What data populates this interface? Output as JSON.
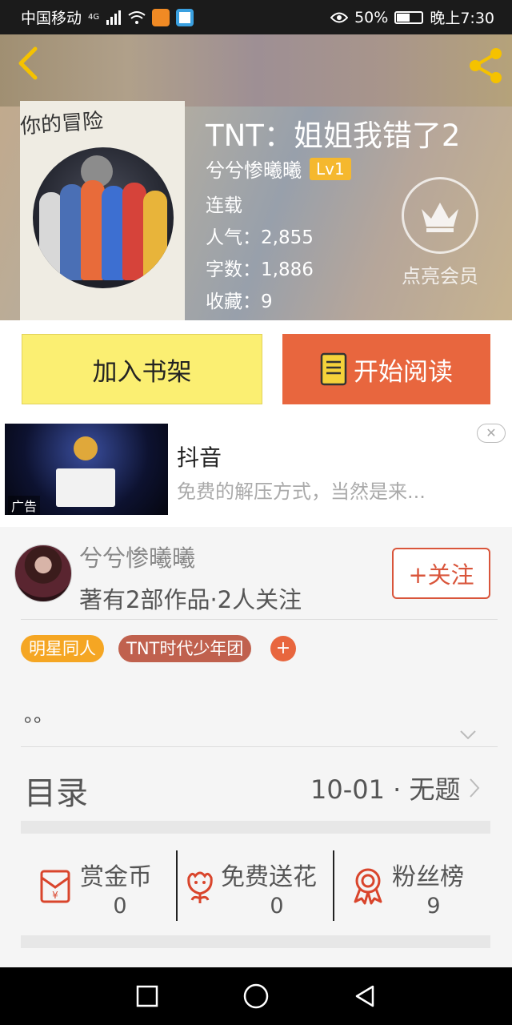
{
  "status_bar": {
    "carrier": "中国移动",
    "network": "4G",
    "battery": "50%",
    "time": "晚上7:30"
  },
  "book": {
    "title": "TNT：姐姐我错了2",
    "author": "兮兮惨曦曦",
    "author_level": "Lv1",
    "status": "连载",
    "popularity": "人气：2,855",
    "word_count": "字数：1,886",
    "favorites": "收藏：9",
    "cover_title": "你的冒险"
  },
  "vip": {
    "label": "点亮会员"
  },
  "actions": {
    "add_to_shelf": "加入书架",
    "start_reading": "开始阅读"
  },
  "ad": {
    "title": "抖音",
    "description": "免费的解压方式，当然是来...",
    "tag": "广告"
  },
  "author_section": {
    "name": "兮兮惨曦曦",
    "works": "著有2部作品·2人关注",
    "follow": "+关注"
  },
  "tags": [
    {
      "label": "明星同人",
      "color": "#f5a623"
    },
    {
      "label": "TNT时代少年团",
      "color": "#c0614e"
    }
  ],
  "tag_add": "+",
  "intro": "。。",
  "toc": {
    "label": "目录",
    "latest": "10-01 · 无题"
  },
  "stats": [
    {
      "label": "赏金币",
      "value": "0",
      "icon": "red-envelope-icon"
    },
    {
      "label": "免费送花",
      "value": "0",
      "icon": "flower-icon"
    },
    {
      "label": "粉丝榜",
      "value": "9",
      "icon": "ribbon-award-icon"
    }
  ],
  "colors": {
    "accent_orange": "#e8663e",
    "shelf_yellow": "#fbef72",
    "level_badge": "#f5b82e",
    "follow_red": "#d9553b"
  }
}
